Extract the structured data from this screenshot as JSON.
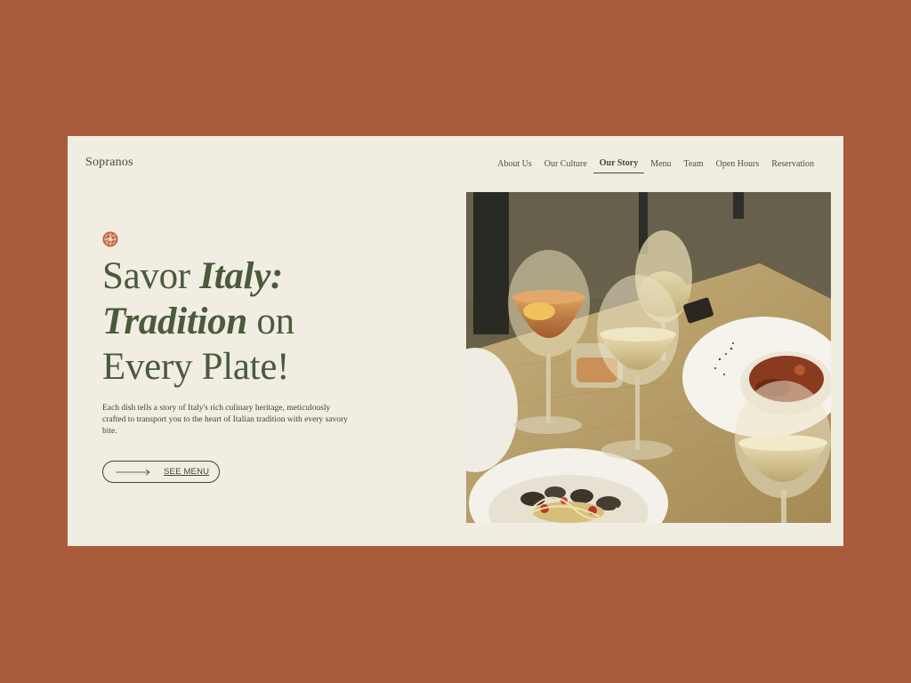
{
  "header": {
    "logo": "Sopranos",
    "nav": [
      {
        "label": "About Us",
        "active": false
      },
      {
        "label": "Our Culture",
        "active": false
      },
      {
        "label": "Our Story",
        "active": true
      },
      {
        "label": "Menu",
        "active": false
      },
      {
        "label": "Team",
        "active": false
      },
      {
        "label": "Open Hours",
        "active": false
      },
      {
        "label": "Reservation",
        "active": false
      }
    ]
  },
  "hero": {
    "icon": "pizza-icon",
    "headline": {
      "part1": "Savor ",
      "part2_italic": "Italy:",
      "part3_italic": "Tradition",
      "part4": " on",
      "part5": "Every Plate!"
    },
    "description": "Each dish tells a story of Italy's rich culinary heritage, meticulously crafted to transport you to the heart of Italian tradition with every savory bite.",
    "cta_label": "SEE MENU",
    "cta_icon": "arrow-right-icon",
    "image_subject": "restaurant-table-photo"
  },
  "colors": {
    "page_background": "#a95c3c",
    "card_background": "#f1ede3",
    "headline_green": "#4b5a3d",
    "text_dark": "#3e4338"
  }
}
